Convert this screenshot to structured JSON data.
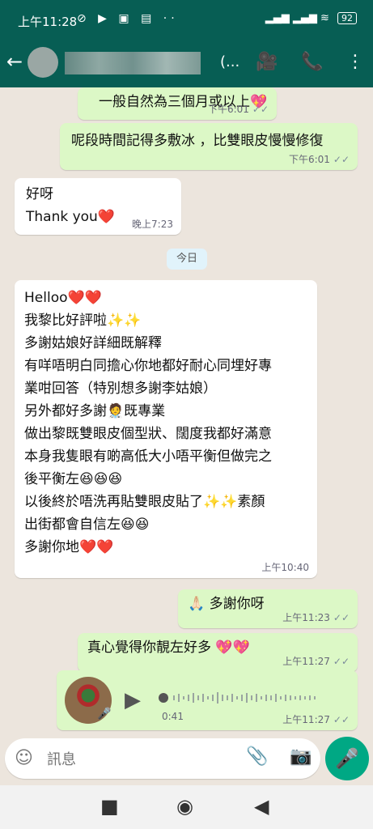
{
  "status_bar": {
    "time": "上午11:28",
    "left_icons": "⊘ ▶ ▣ ▤ ··",
    "signal_icons": "▂▄▆ ▂▄▆ ≋",
    "battery": "92"
  },
  "header": {
    "back_icon": "←",
    "contact_name": "(...",
    "video_icon": "🎥",
    "call_icon": "📞",
    "menu_icon": "⋮"
  },
  "messages": [
    {
      "dir": "out",
      "text": "一般自然為三個月或以上💖",
      "time": "下午6:01"
    },
    {
      "dir": "out",
      "text": "呢段時間記得多敷冰 ，比雙眼皮慢慢修復",
      "time": "下午6:01"
    },
    {
      "dir": "in",
      "lines": [
        "好呀",
        "Thank you❤️"
      ],
      "time": "晚上7:23"
    },
    {
      "dir": "in",
      "lines": [
        "Helloo❤️❤️",
        "我黎比好評啦✨✨",
        "多謝姑娘好詳細既解釋",
        "有咩唔明白同擔心你地都好耐心同埋好專",
        "業咁回答（特別想多謝李姑娘）",
        "另外都好多謝🧑‍⚕️既專業",
        "做出黎既雙眼皮個型狀、闊度我都好滿意",
        "本身我隻眼有啲高低大小唔平衡但做完之",
        "後平衡左😆😆😆",
        "以後終於唔洗再貼雙眼皮貼了✨✨素顏",
        "出街都會自信左😆😆",
        "多謝你地❤️❤️"
      ],
      "time": "上午10:40"
    },
    {
      "dir": "out",
      "text": "🙏🏻 多謝你呀",
      "time": "上午11:23"
    },
    {
      "dir": "out",
      "text": "真心覺得你靚左好多 💖💖",
      "time": "上午11:27"
    }
  ],
  "date_chip": "今日",
  "voice": {
    "duration": "0:41",
    "time": "上午11:27",
    "play_icon": "▶"
  },
  "ticks": "✓✓",
  "composer": {
    "placeholder": "訊息",
    "emoji_icon": "☺",
    "attach_icon": "📎",
    "camera_icon": "📷",
    "mic_icon": "🎤"
  },
  "nav": {
    "recent": "■",
    "home": "◉",
    "back": "◀"
  }
}
